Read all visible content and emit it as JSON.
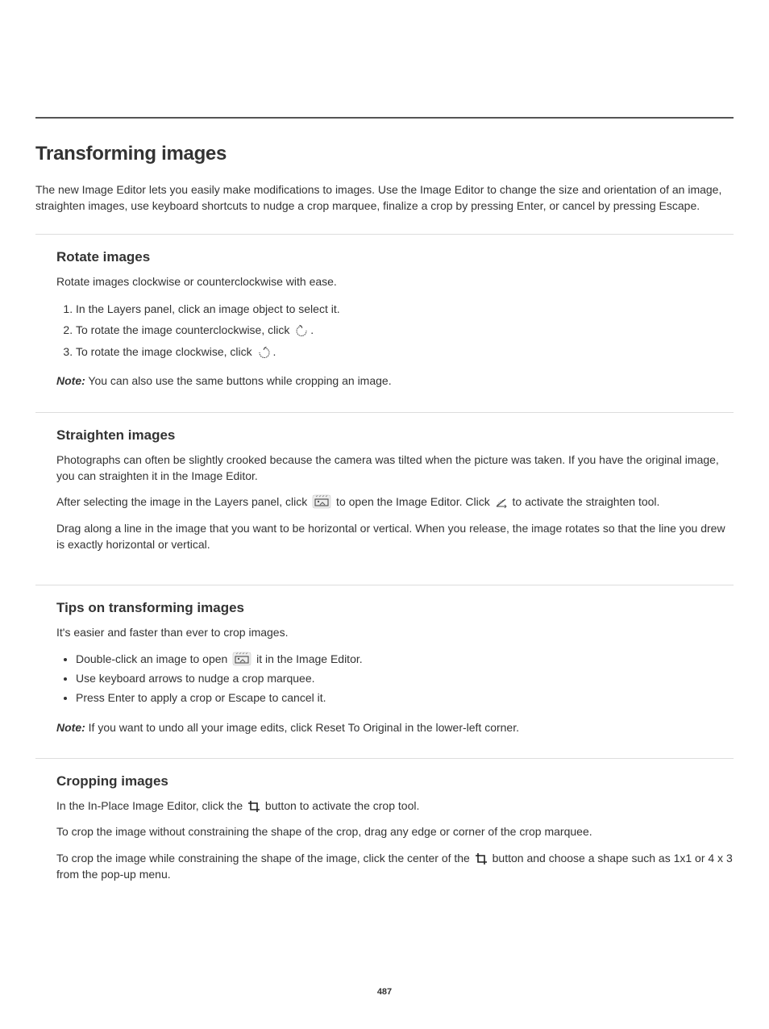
{
  "title": "Transforming images",
  "intro": "The new Image Editor lets you easily make modifications to images. Use the Image Editor to change the size and orientation of an image, straighten images, use keyboard shortcuts to nudge a crop marquee, finalize a crop by pressing Enter, or cancel by pressing Escape.",
  "sections": [
    {
      "heading": "Rotate images",
      "descr": "Rotate images clockwise or counterclockwise with ease.",
      "list_type": "ordered",
      "items": [
        {
          "pre": "In the Layers panel, click an image object to select it.",
          "icon": null,
          "post": ""
        },
        {
          "pre": "To rotate the image counterclockwise, click ",
          "icon": "rotate-ccw",
          "post": "."
        },
        {
          "pre": "To rotate the image clockwise, click ",
          "icon": "rotate-cw",
          "post": "."
        }
      ],
      "note": {
        "label": "Note:",
        "text": " You can also use the same buttons while cropping an image."
      }
    },
    {
      "heading": "Straighten images",
      "descr_parts": [
        "Photographs can often be slightly crooked because the camera was tilted when the picture was taken. If you have the original image, you can straighten it in the Image Editor.",
        "After selecting the image in the Layers panel, click ",
        " to open the Image Editor. Click ",
        " to activate the straighten tool.",
        "Drag along a line in the image that you want to be horizontal or vertical. When you release, the image rotates so that the line you drew is exactly horizontal or vertical."
      ],
      "icons": [
        "image-editor",
        "straighten"
      ],
      "note": null
    },
    {
      "heading": "Tips on transforming images",
      "descr": "It's easier and faster than ever to crop images.",
      "list_type": "unordered",
      "items": [
        {
          "pre": "Double-click an image to open ",
          "icon": "image-editor",
          "post": " it in the Image Editor."
        },
        {
          "pre": "Use keyboard arrows to nudge a crop marquee.",
          "icon": null,
          "post": ""
        },
        {
          "pre": "Press Enter to apply a crop or Escape to cancel it.",
          "icon": null,
          "post": ""
        }
      ],
      "note": {
        "label": "Note:",
        "text": " If you want to undo all your image edits, click Reset To Original in the lower-left corner."
      }
    },
    {
      "heading": "Cropping images",
      "descr_parts": [
        "In the In-Place Image Editor, click the ",
        " button to activate the crop tool.",
        "To crop the image without constraining the shape of the crop, drag any edge or corner of the crop marquee.",
        "To crop the image while constraining the shape of the image, click the center of the ",
        " button and choose a shape such as 1x1 or 4 x 3 from the pop-up menu."
      ],
      "icons": [
        "crop",
        "crop"
      ],
      "note": null
    }
  ],
  "page_number": "487"
}
